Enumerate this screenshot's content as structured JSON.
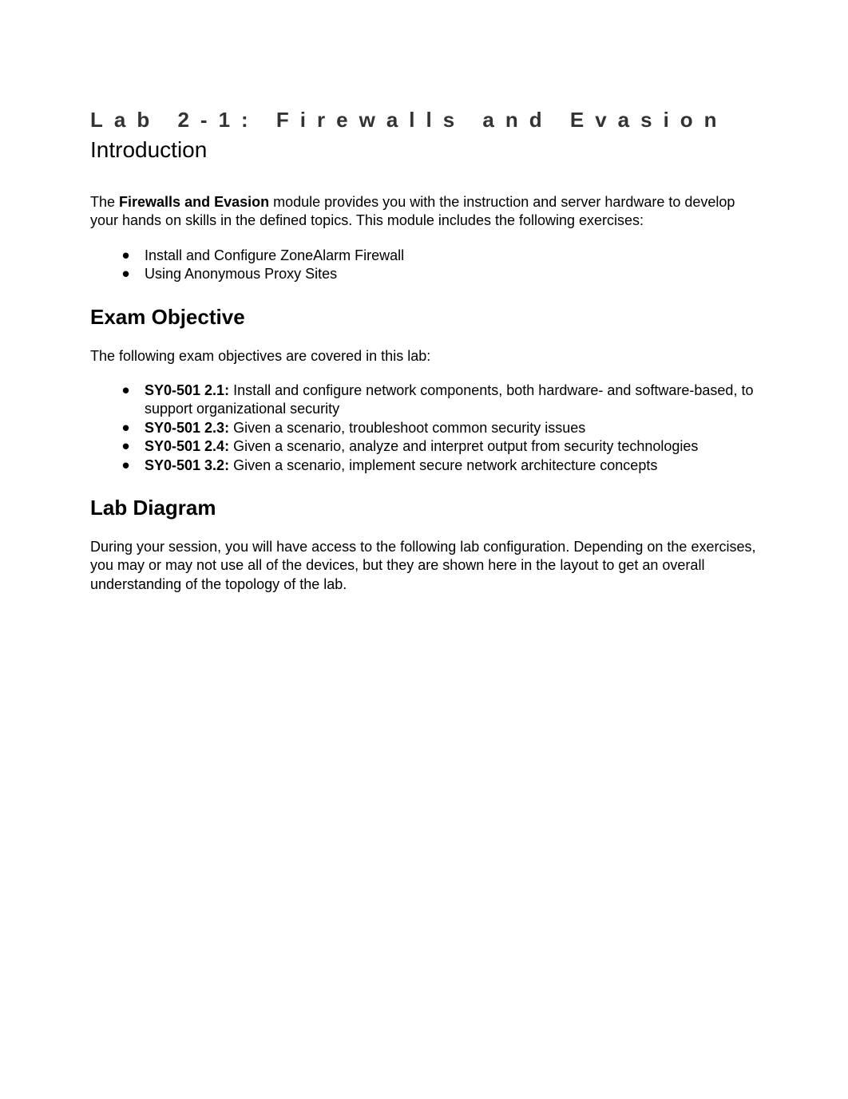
{
  "lab_title": "Lab 2-1: Firewalls and Evasion",
  "intro_heading": "Introduction",
  "intro_text_pre": "The ",
  "intro_text_bold": "Firewalls and Evasion",
  "intro_text_post": " module provides you with the instruction and server hardware to develop your hands on skills in the defined topics. This module includes the following exercises:",
  "exercises": [
    "Install and Configure ZoneAlarm Firewall",
    "Using Anonymous Proxy Sites"
  ],
  "exam_objective_heading": "Exam Objective",
  "exam_objective_intro": "The following exam objectives are covered in this lab:",
  "objectives": [
    {
      "code": "SY0-501 2.1:",
      "text": " Install and configure network components, both hardware- and software-based, to support organizational security"
    },
    {
      "code": "SY0-501 2.3:",
      "text": " Given a scenario, troubleshoot common security issues"
    },
    {
      "code": "SY0-501 2.4:",
      "text": " Given a scenario, analyze and interpret output from security technologies"
    },
    {
      "code": "SY0-501 3.2:",
      "text": " Given a scenario, implement secure network architecture concepts"
    }
  ],
  "lab_diagram_heading": "Lab Diagram",
  "lab_diagram_text": "During your session, you will have access to the following lab configuration. Depending on the exercises, you may or may not use all of the devices, but they are shown here in the layout to get an overall understanding of the topology of the lab."
}
